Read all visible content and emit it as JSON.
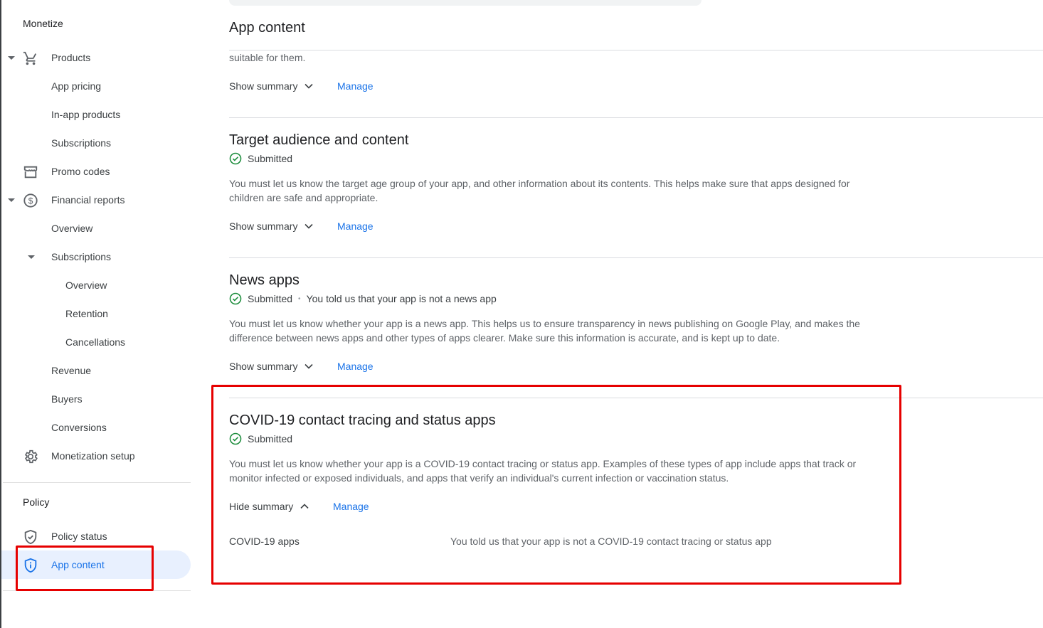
{
  "sidebar": {
    "monetize_heading": "Monetize",
    "policy_heading": "Policy",
    "items": [
      {
        "label": "Products",
        "icon": "cart-icon"
      },
      {
        "label": "App pricing"
      },
      {
        "label": "In-app products"
      },
      {
        "label": "Subscriptions"
      },
      {
        "label": "Promo codes",
        "icon": "storefront-icon"
      },
      {
        "label": "Financial reports",
        "icon": "dollar-icon"
      },
      {
        "label": "Overview"
      },
      {
        "label": "Subscriptions"
      },
      {
        "label": "Overview"
      },
      {
        "label": "Retention"
      },
      {
        "label": "Cancellations"
      },
      {
        "label": "Revenue"
      },
      {
        "label": "Buyers"
      },
      {
        "label": "Conversions"
      },
      {
        "label": "Monetization setup",
        "icon": "gear-icon"
      }
    ],
    "policy_items": [
      {
        "label": "Policy status",
        "icon": "shield-check-icon"
      },
      {
        "label": "App content",
        "icon": "shield-info-icon"
      }
    ]
  },
  "main": {
    "title": "App content",
    "partial_text": "suitable for them.",
    "show_summary": "Show summary",
    "hide_summary": "Hide summary",
    "manage": "Manage",
    "sections": [
      {
        "title": "Target audience and content",
        "status": "Submitted",
        "description": "You must let us know the target age group of your app, and other information about its contents. This helps make sure that apps designed for children are safe and appropriate."
      },
      {
        "title": "News apps",
        "status": "Submitted",
        "status_note": "You told us that your app is not a news app",
        "description": "You must let us know whether your app is a news app. This helps us to ensure transparency in news publishing on Google Play, and makes the difference between news apps and other types of apps clearer. Make sure this information is accurate, and is kept up to date."
      },
      {
        "title": "COVID-19 contact tracing and status apps",
        "status": "Submitted",
        "description": "You must let us know whether your app is a COVID-19 contact tracing or status app. Examples of these types of app include apps that track or monitor infected or exposed individuals, and apps that verify an individual's current infection or vaccination status.",
        "summary_key": "COVID-19 apps",
        "summary_value": "You told us that your app is not a COVID-19 contact tracing or status app"
      }
    ]
  },
  "colors": {
    "accent": "#1a73e8",
    "active_bg": "#e8f0fe",
    "success": "#1e8e3e",
    "highlight": "#e60000"
  }
}
